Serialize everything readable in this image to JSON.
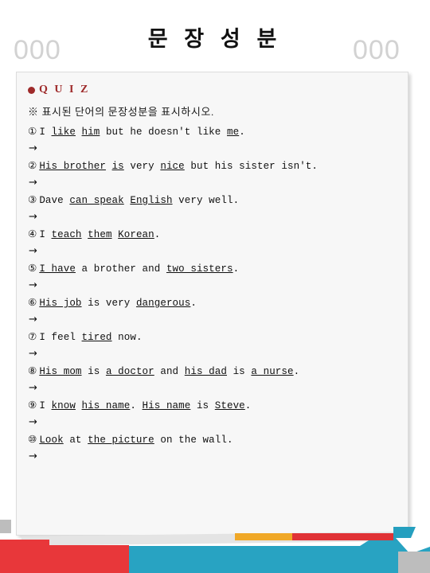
{
  "header": {
    "title": "문 장 성 분",
    "number_placeholder_left": "000",
    "number_placeholder_right": "000"
  },
  "card": {
    "quiz_heading": "Q U I Z",
    "quiz_bullet_icon": "filled-circle-bullet",
    "instruction": "※ 표시된 단어의 문장성분을 표시하시오.",
    "answer_arrow": "→",
    "items": [
      {
        "marker": "①",
        "text": "I like him but he doesn't like me.",
        "parts": [
          {
            "t": "I ",
            "u": false
          },
          {
            "t": "like",
            "u": true
          },
          {
            "t": " ",
            "u": false
          },
          {
            "t": "him",
            "u": true
          },
          {
            "t": " but he doesn't like ",
            "u": false
          },
          {
            "t": "me",
            "u": true
          },
          {
            "t": ".",
            "u": false
          }
        ]
      },
      {
        "marker": "②",
        "text": "His brother is very nice but his sister isn't.",
        "parts": [
          {
            "t": "His brother",
            "u": true
          },
          {
            "t": " ",
            "u": false
          },
          {
            "t": "is",
            "u": true
          },
          {
            "t": " very ",
            "u": false
          },
          {
            "t": "nice",
            "u": true
          },
          {
            "t": " but his sister isn't.",
            "u": false
          }
        ]
      },
      {
        "marker": "③",
        "text": "Dave can speak English very well.",
        "parts": [
          {
            "t": "Dave ",
            "u": false
          },
          {
            "t": "can speak",
            "u": true
          },
          {
            "t": " ",
            "u": false
          },
          {
            "t": "English",
            "u": true
          },
          {
            "t": " very well.",
            "u": false
          }
        ]
      },
      {
        "marker": "④",
        "text": "I teach them Korean.",
        "parts": [
          {
            "t": "I ",
            "u": false
          },
          {
            "t": "teach",
            "u": true
          },
          {
            "t": " ",
            "u": false
          },
          {
            "t": "them",
            "u": true
          },
          {
            "t": " ",
            "u": false
          },
          {
            "t": "Korean",
            "u": true
          },
          {
            "t": ".",
            "u": false
          }
        ]
      },
      {
        "marker": "⑤",
        "text": "I have a brother and two sisters.",
        "parts": [
          {
            "t": "I have",
            "u": true
          },
          {
            "t": " a brother and ",
            "u": false
          },
          {
            "t": "two sisters",
            "u": true
          },
          {
            "t": ".",
            "u": false
          }
        ]
      },
      {
        "marker": "⑥",
        "text": "His job is very dangerous.",
        "parts": [
          {
            "t": "His job",
            "u": true
          },
          {
            "t": " is very ",
            "u": false
          },
          {
            "t": "dangerous",
            "u": true
          },
          {
            "t": ".",
            "u": false
          }
        ]
      },
      {
        "marker": "⑦",
        "text": "I feel tired now.",
        "parts": [
          {
            "t": "I feel ",
            "u": false
          },
          {
            "t": "tired",
            "u": true
          },
          {
            "t": " now.",
            "u": false
          }
        ]
      },
      {
        "marker": "⑧",
        "text": "His mom is a doctor and his dad is a nurse.",
        "parts": [
          {
            "t": "His mom",
            "u": true
          },
          {
            "t": " is ",
            "u": false
          },
          {
            "t": "a doctor",
            "u": true
          },
          {
            "t": " and ",
            "u": false
          },
          {
            "t": "his dad",
            "u": true
          },
          {
            "t": " is ",
            "u": false
          },
          {
            "t": "a nurse",
            "u": true
          },
          {
            "t": ".",
            "u": false
          }
        ]
      },
      {
        "marker": "⑨",
        "text": "I know his name. His name is Steve.",
        "parts": [
          {
            "t": "I ",
            "u": false
          },
          {
            "t": "know",
            "u": true
          },
          {
            "t": " ",
            "u": false
          },
          {
            "t": "his name",
            "u": true
          },
          {
            "t": ". ",
            "u": false
          },
          {
            "t": "His name",
            "u": true
          },
          {
            "t": " is ",
            "u": false
          },
          {
            "t": "Steve",
            "u": true
          },
          {
            "t": ".",
            "u": false
          }
        ]
      },
      {
        "marker": "⑩",
        "text": "Look at the picture on the wall.",
        "parts": [
          {
            "t": "Look",
            "u": true
          },
          {
            "t": " at ",
            "u": false
          },
          {
            "t": "the picture",
            "u": true
          },
          {
            "t": " on the wall.",
            "u": false
          }
        ]
      }
    ]
  },
  "footer_decoration": {
    "colors": {
      "red": "#e8373a",
      "red_bar": "#e03236",
      "orange": "#f0a827",
      "teal": "#28a3c2",
      "teal_tab": "#259fbf",
      "gray": "#bdbdbd",
      "sheet": "#e4e4e4"
    }
  }
}
